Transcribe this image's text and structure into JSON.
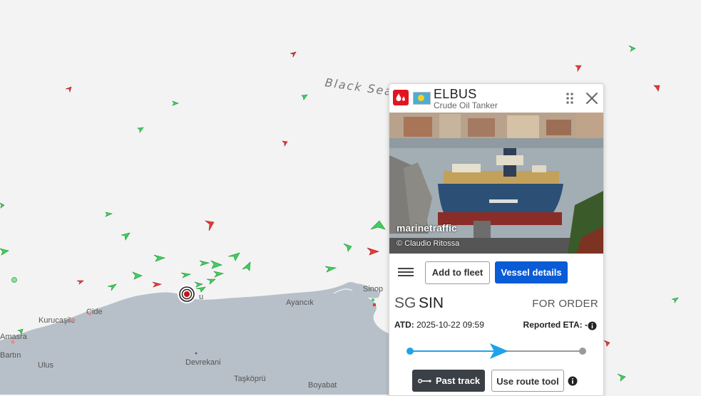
{
  "map": {
    "sea_label": "Black Sea",
    "places": [
      "Sinop",
      "Ayancık",
      "Cide",
      "Kurucaşile",
      "Amasra",
      "Bartın",
      "Ulus",
      "Devrekani",
      "Taşköprü",
      "Boyabat",
      "u"
    ],
    "colors": {
      "land": "#b7c0c8",
      "water": "#f3f3f3",
      "tanker": "#e33b3b",
      "cargo": "#3fcf5b"
    }
  },
  "vessel": {
    "name": "ELBUS",
    "type": "Crude Oil Tanker",
    "type_badge_icon": "oil-drop-icon",
    "flag_icon": "palau-flag-icon",
    "photo_logo": "marinetraffic",
    "photo_credit": "© Claudio Ritossa",
    "port_country": "SG",
    "port_code": "SIN",
    "destination": "FOR ORDER",
    "atd_label": "ATD:",
    "atd_value": "2025-10-22 09:59",
    "eta_label": "Reported ETA:",
    "eta_value": "-",
    "voyage_progress": 0.52
  },
  "actions": {
    "add_to_fleet": "Add to fleet",
    "vessel_details": "Vessel details",
    "past_track": "Past track",
    "route_tool": "Use route tool"
  },
  "colors": {
    "primary": "#0a5bd6",
    "dark_button": "#3b3f46",
    "progress": "#1fa3ea"
  }
}
